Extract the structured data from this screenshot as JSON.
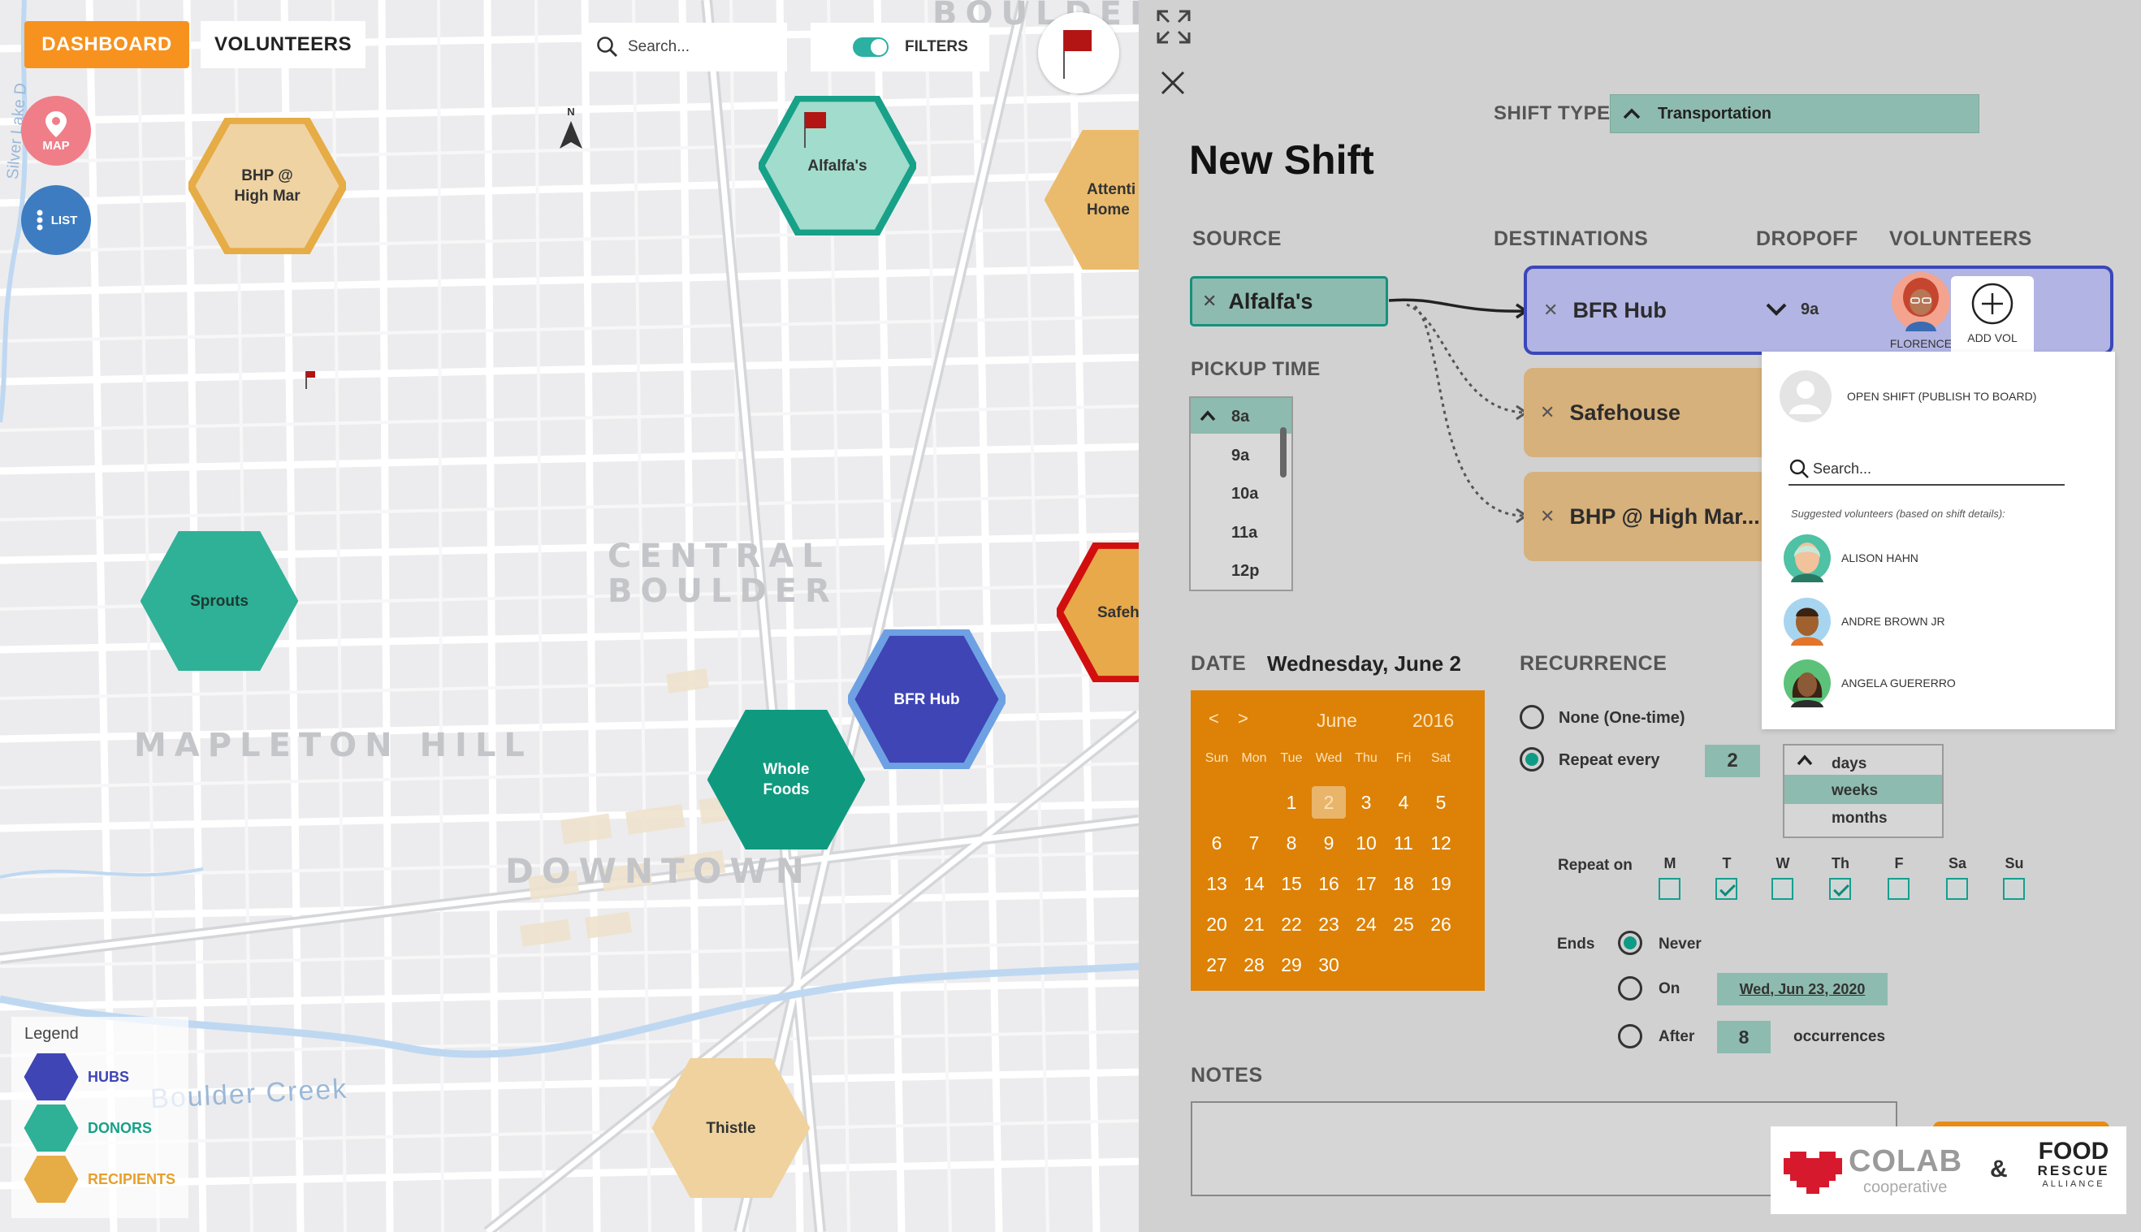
{
  "nav": {
    "dashboard": "DASHBOARD",
    "volunteers": "VOLUNTEERS",
    "search_placeholder": "Search...",
    "filters": "FILTERS",
    "map_btn": "MAP",
    "list_btn": "LIST",
    "compass": "N"
  },
  "map": {
    "areas": {
      "central1": "CENTRAL",
      "central2": "BOULDER",
      "mapleton": "MAPLETON HILL",
      "downtown": "DOWNTOWN",
      "boulder_top": "BOULDER",
      "creek": "Boulder Creek",
      "silver_lake": "Silver Lake D"
    },
    "nodes": {
      "bhp": "BHP @\nHigh Mar",
      "alfalfas": "Alfalfa's",
      "attention": "Attenti\nHome",
      "sprouts": "Sprouts",
      "safehouse": "Safeh",
      "bfr_hub": "BFR Hub",
      "whole_foods": "Whole\nFoods",
      "thistle": "Thistle"
    },
    "legend": {
      "title": "Legend",
      "hubs": "HUBS",
      "donors": "DONORS",
      "recipients": "RECIPIENTS"
    }
  },
  "panel": {
    "title": "New Shift",
    "shift_type_label": "SHIFT TYPE",
    "shift_type_value": "Transportation",
    "source_label": "SOURCE",
    "destinations_label": "DESTINATIONS",
    "dropoff_label": "DROPOFF",
    "volunteers_label": "VOLUNTEERS",
    "source_value": "Alfalfa's",
    "destinations": [
      {
        "name": "BFR Hub",
        "dropoff": "9a"
      },
      {
        "name": "Safehouse"
      },
      {
        "name": "BHP @ High Mar..."
      }
    ],
    "assigned_volunteer": "FLORENCE",
    "add_vol": "ADD VOL",
    "pickup_label": "PICKUP TIME",
    "pickup_times": [
      "8a",
      "9a",
      "10a",
      "11a",
      "12p"
    ],
    "volunteer_dropdown": {
      "open_shift": "OPEN SHIFT (PUBLISH TO BOARD)",
      "search_placeholder": "Search...",
      "suggested_label": "Suggested volunteers (based on shift details):",
      "volunteers": [
        "ALISON HAHN",
        "ANDRE BROWN JR",
        "ANGELA GUERERRO"
      ]
    },
    "date_label": "DATE",
    "date_value": "Wednesday, June 2",
    "calendar": {
      "prev": "<",
      "next": ">",
      "month": "June",
      "year": "2016",
      "dow": [
        "Sun",
        "Mon",
        "Tue",
        "Wed",
        "Thu",
        "Fri",
        "Sat"
      ],
      "weeks": [
        [
          "",
          "",
          "1",
          "2",
          "3",
          "4",
          "5"
        ],
        [
          "6",
          "7",
          "8",
          "9",
          "10",
          "11",
          "12"
        ],
        [
          "13",
          "14",
          "15",
          "16",
          "17",
          "18",
          "19"
        ],
        [
          "20",
          "21",
          "22",
          "23",
          "24",
          "25",
          "26"
        ],
        [
          "27",
          "28",
          "29",
          "30",
          "",
          "",
          ""
        ]
      ],
      "selected": "2"
    },
    "recurrence": {
      "label": "RECURRENCE",
      "none": "None (One-time)",
      "repeat_every": "Repeat every",
      "interval": "2",
      "units": [
        "days",
        "weeks",
        "months"
      ],
      "selected_unit": "weeks",
      "repeat_on": "Repeat on",
      "days": [
        "M",
        "T",
        "W",
        "Th",
        "F",
        "Sa",
        "Su"
      ],
      "days_checked": [
        false,
        true,
        false,
        true,
        false,
        false,
        false
      ],
      "ends": "Ends",
      "never": "Never",
      "on": "On",
      "on_date": "Wed, Jun 23, 2020",
      "after": "After",
      "occurrences_value": "8",
      "occurrences": "occurrences"
    },
    "notes_label": "NOTES",
    "logos": {
      "colab": "COLAB",
      "colab_sub": "cooperative",
      "amp": "&",
      "food": "FOOD",
      "rescue": "RESCUE",
      "alliance": "ALLIANCE"
    }
  },
  "colors": {
    "hub": "#3f45b5",
    "donor": "#2fb197",
    "recipient": "#e6ac45",
    "accent": "#f7921e",
    "calendar": "#dd8207"
  }
}
